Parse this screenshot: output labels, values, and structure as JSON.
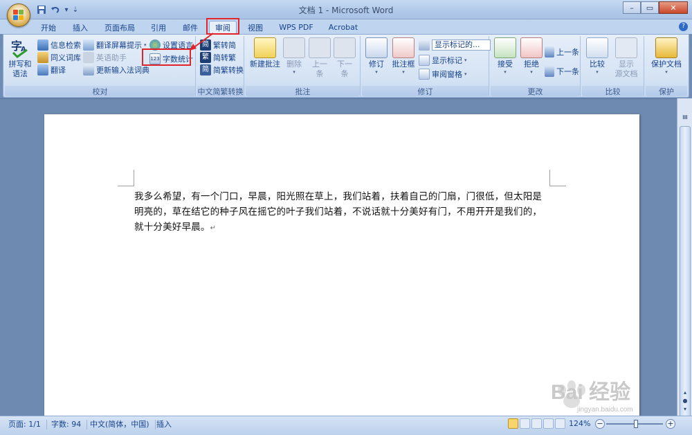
{
  "window": {
    "title": "文档 1 - Microsoft Word",
    "controls": [
      "minimize",
      "maximize",
      "close"
    ]
  },
  "quick_access": [
    "save-icon",
    "undo-icon",
    "redo-icon",
    "customize-icon"
  ],
  "tabs": [
    {
      "label": "开始"
    },
    {
      "label": "插入"
    },
    {
      "label": "页面布局"
    },
    {
      "label": "引用"
    },
    {
      "label": "邮件"
    },
    {
      "label": "审阅",
      "active": true
    },
    {
      "label": "视图"
    },
    {
      "label": "WPS PDF"
    },
    {
      "label": "Acrobat"
    }
  ],
  "ribbon": {
    "proofing": {
      "label": "校对",
      "spell_check": {
        "line1": "拼写和",
        "line2": "语法"
      },
      "research": "信息检索",
      "thesaurus": "同义词库",
      "translate": "翻译",
      "translation_tip": "翻译屏幕提示",
      "english_assistant": "英语助手",
      "update_ime": "更新输入法词典",
      "set_language": "设置语言",
      "word_count": "字数统计"
    },
    "chinese_conversion": {
      "label": "中文简繁转换",
      "to_simplified": "繁转简",
      "to_traditional": "简转繁",
      "conversion": "简繁转换"
    },
    "comments": {
      "label": "批注",
      "new_comment": "新建批注",
      "delete": "删除",
      "previous": {
        "line1": "上一",
        "line2": "条"
      },
      "next": {
        "line1": "下一",
        "line2": "条"
      }
    },
    "tracking": {
      "label": "修订",
      "track_changes": "修订",
      "balloons": "批注框",
      "display_for_review": "显示标记的...",
      "show_markup": "显示标记",
      "reviewing_pane": "审阅窗格"
    },
    "changes": {
      "label": "更改",
      "accept": "接受",
      "reject": "拒绝",
      "previous": "上一条",
      "next": "下一条"
    },
    "compare": {
      "label": "比较",
      "compare": "比较",
      "show_source": {
        "line1": "显示",
        "line2": "源文档"
      }
    },
    "protect": {
      "label": "保护",
      "protect_document": "保护文档"
    }
  },
  "document": {
    "text": "我多么希望，有一个门口，早晨，阳光照在草上，我们站着，扶着自己的门扇，门很低，但太阳是明亮的，草在结它的种子风在摇它的叶子我们站着，不说话就十分美好有门，不用开开是我们的，就十分美好早晨。",
    "para_mark": "↵"
  },
  "status": {
    "page": "页面: 1/1",
    "word_count": "字数: 94",
    "language": "中文(简体，中国)",
    "mode": "插入",
    "zoom": "124%",
    "zoom_level": 124
  },
  "watermark": {
    "brand": "Bai  经验",
    "url": "jingyan.baidu.com"
  },
  "colors": {
    "highlight": "#e2242a",
    "ribbon_bg": "#dbe6f5",
    "tab_text": "#15428b"
  }
}
